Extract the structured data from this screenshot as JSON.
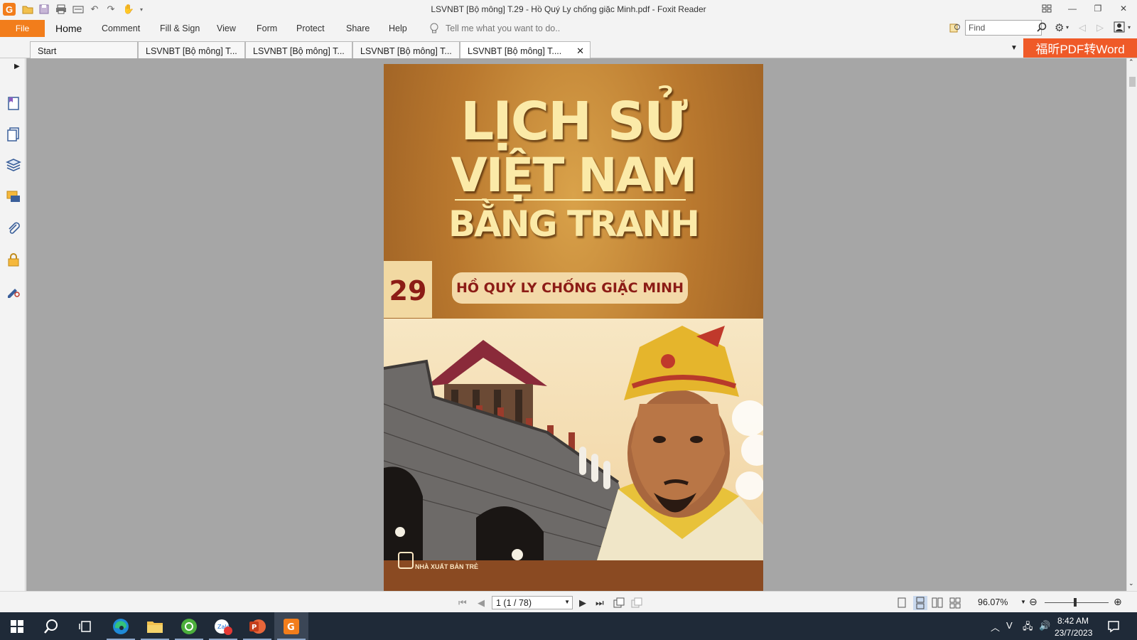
{
  "window": {
    "title": "LSVNBT [Bộ mông] T.29 - Hồ Quý Ly chống giặc Minh.pdf - Foxit Reader",
    "app_logo": "G"
  },
  "menu": {
    "file": "File",
    "items": [
      "Home",
      "Comment",
      "Fill & Sign",
      "View",
      "Form",
      "Protect",
      "Share",
      "Help"
    ],
    "tell_me": "Tell me what you want to do..",
    "find_placeholder": "Find"
  },
  "tabs": {
    "items": [
      "Start",
      "LSVNBT [Bộ mông] T...",
      "LSVNBT [Bộ mông] T...",
      "LSVNBT [Bộ mông] T...",
      "LSVNBT [Bộ mông] T...."
    ],
    "close": "✕",
    "promo": "福昕PDF转Word"
  },
  "cover": {
    "title_line1": "LỊCH SỬ",
    "title_line2": "VIỆT NAM",
    "title_line3": "BẰNG TRANH",
    "volume": "29",
    "subtitle": "HỒ QUÝ LY CHỐNG GIẶC MINH",
    "publisher": "NHÀ XUẤT BẢN TRẺ"
  },
  "status": {
    "page_indicator": "1 (1 / 78)",
    "zoom": "96.07%"
  },
  "taskbar": {
    "time": "8:42 AM",
    "date": "23/7/2023"
  },
  "colors": {
    "accent": "#f27d1b",
    "promo": "#ef5a28",
    "viewer_bg": "#a6a6a6",
    "taskbar": "#1f2a38"
  }
}
